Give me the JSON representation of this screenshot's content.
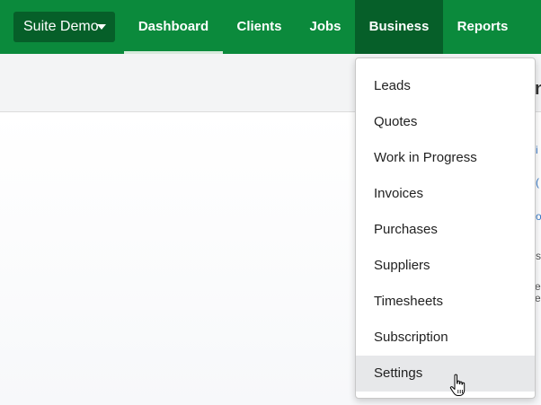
{
  "navbar": {
    "suite_button": "Suite Demo",
    "items": [
      {
        "label": "Dashboard"
      },
      {
        "label": "Clients"
      },
      {
        "label": "Jobs"
      },
      {
        "label": "Business"
      },
      {
        "label": "Reports"
      }
    ],
    "active_item": "Dashboard",
    "open_menu": "Business"
  },
  "business_menu": {
    "items": [
      {
        "label": "Leads"
      },
      {
        "label": "Quotes"
      },
      {
        "label": "Work in Progress"
      },
      {
        "label": "Invoices"
      },
      {
        "label": "Purchases"
      },
      {
        "label": "Suppliers"
      },
      {
        "label": "Timesheets"
      },
      {
        "label": "Subscription"
      },
      {
        "label": "Settings"
      }
    ],
    "hovered_item": "Settings"
  },
  "colors": {
    "nav_green": "#0b8a3c",
    "nav_dark_green": "#065f29",
    "menu_hover": "#e7e8ea"
  },
  "icons": {
    "suite_caret": "caret-down-icon",
    "pointer": "hand-pointer-cursor"
  }
}
